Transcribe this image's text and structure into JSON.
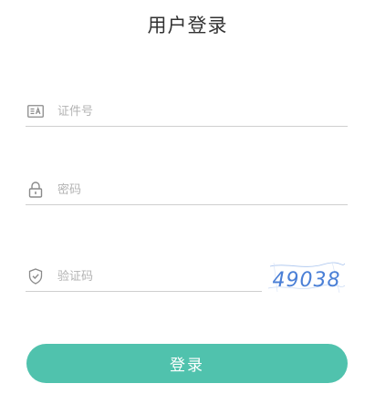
{
  "page": {
    "title": "用户登录"
  },
  "form": {
    "id_field": {
      "icon": "id-card-icon",
      "placeholder": "证件号",
      "value": ""
    },
    "password_field": {
      "icon": "lock-icon",
      "placeholder": "密码",
      "value": ""
    },
    "captcha_field": {
      "icon": "shield-icon",
      "placeholder": "验证码",
      "value": ""
    },
    "captcha_image": {
      "text": "49038",
      "color": "#4a7fd6"
    },
    "login_button": {
      "label": "登录",
      "color": "#50c2ad"
    }
  }
}
